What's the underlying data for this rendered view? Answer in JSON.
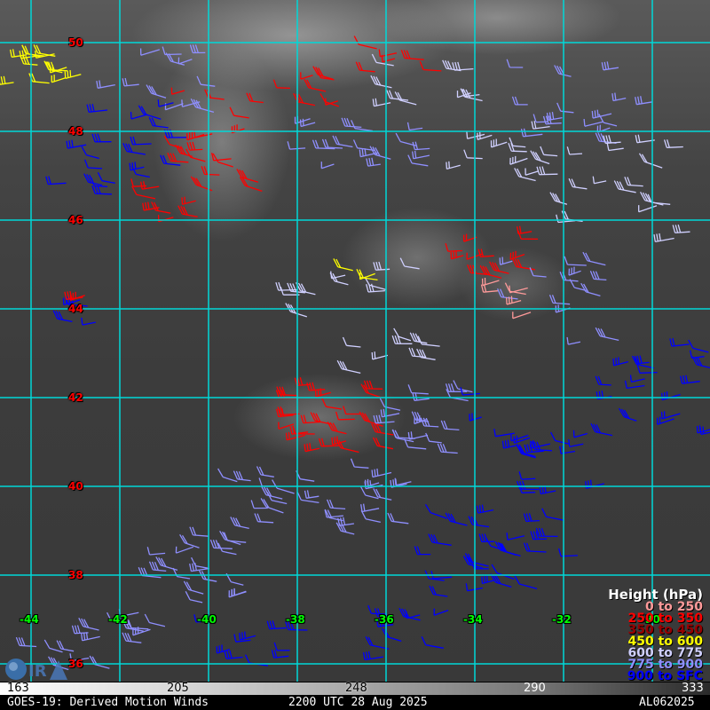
{
  "map": {
    "latitude_labels": [
      "50",
      "48",
      "46",
      "44",
      "42",
      "40",
      "38",
      "36"
    ],
    "longitude_labels": [
      "-44",
      "-42",
      "-40",
      "-38",
      "-36",
      "-34",
      "-32",
      "-30"
    ]
  },
  "legend": {
    "title": "Height (hPa)",
    "items": [
      {
        "label": "0 to 250",
        "color": "#ff9a9a"
      },
      {
        "label": "250 to 350",
        "color": "#ff0000"
      },
      {
        "label": "350 to 450",
        "color": "#990000"
      },
      {
        "label": "450 to 600",
        "color": "#ffff00"
      },
      {
        "label": "600 to 775",
        "color": "#d0d0ff"
      },
      {
        "label": "775 to 900",
        "color": "#8f8fff"
      },
      {
        "label": "900 to SFC",
        "color": "#0000ff"
      }
    ]
  },
  "colorbar": {
    "ticks": [
      "163",
      "205",
      "248",
      "290",
      "333"
    ]
  },
  "footer": {
    "title": "GOES-19: Derived Motion Winds",
    "time": "2200 UTC 28 Aug 2025",
    "storm_id": "AL062025"
  },
  "logo": {
    "text": "CIRA"
  }
}
